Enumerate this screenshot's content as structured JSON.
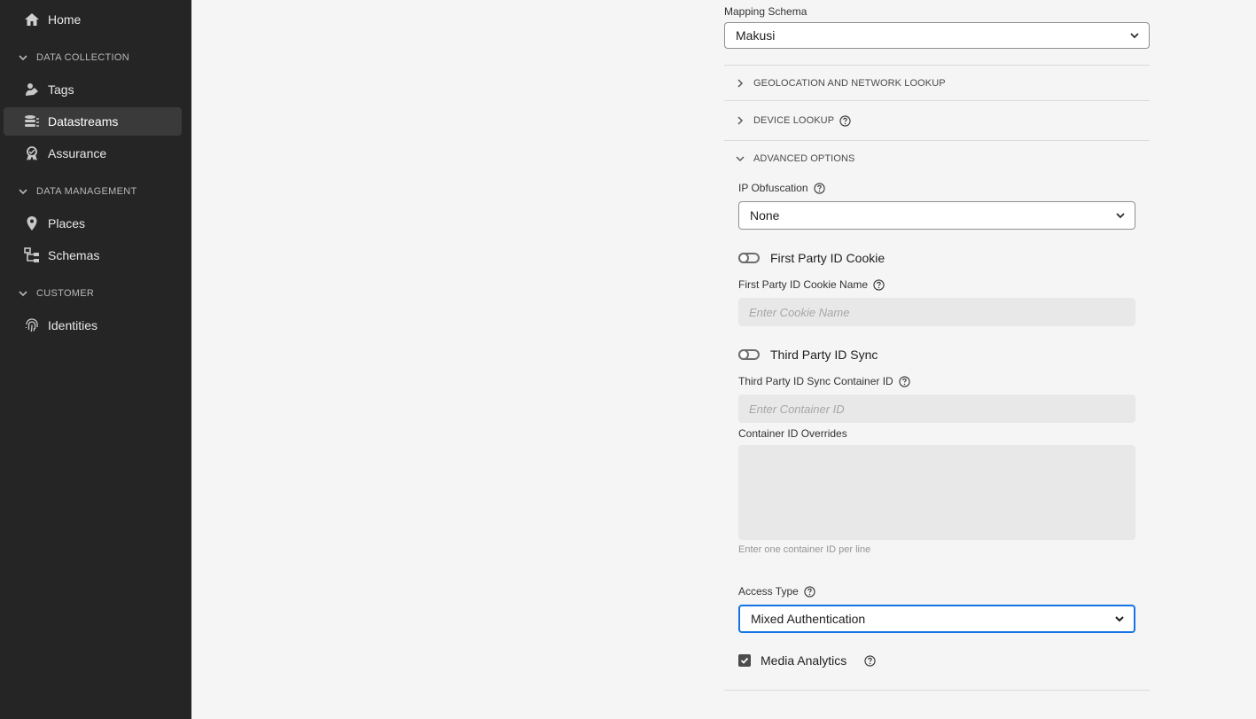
{
  "sidebar": {
    "home": {
      "label": "Home",
      "icon": "home-icon"
    },
    "sections": [
      {
        "label": "DATA COLLECTION"
      },
      {
        "label": "DATA MANAGEMENT"
      },
      {
        "label": "CUSTOMER"
      }
    ],
    "items": [
      {
        "label": "Tags",
        "icon": "tags-icon"
      },
      {
        "label": "Datastreams",
        "icon": "datastreams-icon",
        "active": true
      },
      {
        "label": "Assurance",
        "icon": "assurance-icon"
      },
      {
        "label": "Places",
        "icon": "places-pin-icon"
      },
      {
        "label": "Schemas",
        "icon": "schemas-icon"
      },
      {
        "label": "Identities",
        "icon": "fingerprint-icon"
      }
    ]
  },
  "form": {
    "mapping_schema": {
      "label": "Mapping Schema",
      "value": "Makusi"
    },
    "accordions": {
      "geolocation": "GEOLOCATION AND NETWORK LOOKUP",
      "device": "DEVICE LOOKUP",
      "advanced": "ADVANCED OPTIONS"
    },
    "ip_obfuscation": {
      "label": "IP Obfuscation",
      "value": "None"
    },
    "first_party_cookie": {
      "toggle_label": "First Party ID Cookie",
      "toggle_on": false,
      "name_label": "First Party ID Cookie Name",
      "placeholder": "Enter Cookie Name"
    },
    "third_party_sync": {
      "toggle_label": "Third Party ID Sync",
      "toggle_on": false,
      "container_label": "Third Party ID Sync Container ID",
      "placeholder": "Enter Container ID"
    },
    "container_overrides": {
      "label": "Container ID Overrides",
      "hint": "Enter one container ID per line"
    },
    "access_type": {
      "label": "Access Type",
      "value": "Mixed Authentication"
    },
    "media_analytics": {
      "label": "Media Analytics",
      "checked": true
    }
  },
  "colors": {
    "sidebar_bg": "#252525",
    "page_bg": "#f5f5f5",
    "focus_blue": "#1473e6"
  }
}
